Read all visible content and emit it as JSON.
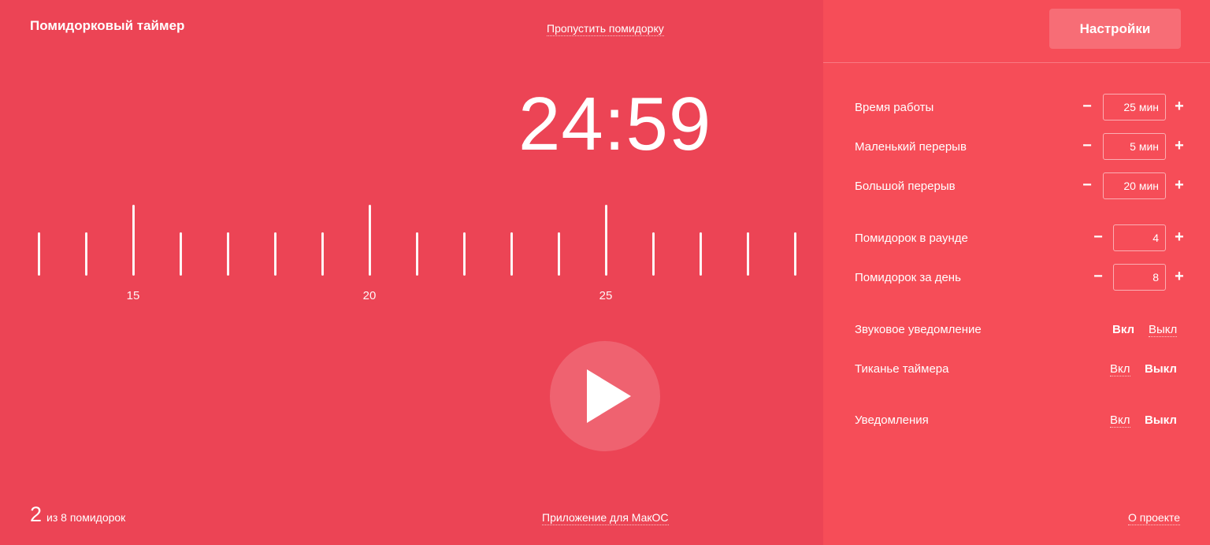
{
  "app": {
    "title": "Помидорковый таймер"
  },
  "header": {
    "skip_label": "Пропустить помидорку"
  },
  "timer": {
    "display": "24:59"
  },
  "ruler": {
    "labels": [
      "15",
      "20",
      "25"
    ]
  },
  "player": {
    "icon": "play-icon"
  },
  "counter": {
    "done": "2",
    "text": "из 8 помидорок"
  },
  "footer": {
    "macos_label": "Приложение для МакОС",
    "about_label": "О проекте"
  },
  "settings": {
    "button_label": "Настройки",
    "minus_label": "−",
    "plus_label": "+",
    "work_time": {
      "label": "Время работы",
      "value": "25 мин"
    },
    "short_break": {
      "label": "Маленький перерыв",
      "value": "5 мин"
    },
    "long_break": {
      "label": "Большой перерыв",
      "value": "20 мин"
    },
    "per_round": {
      "label": "Помидорок в раунде",
      "value": "4"
    },
    "per_day": {
      "label": "Помидорок за день",
      "value": "8"
    },
    "sound": {
      "label": "Звуковое уведомление",
      "on": "Вкл",
      "off": "Выкл",
      "selected": "on"
    },
    "ticking": {
      "label": "Тиканье таймера",
      "on": "Вкл",
      "off": "Выкл",
      "selected": "off"
    },
    "notifications": {
      "label": "Уведомления",
      "on": "Вкл",
      "off": "Выкл",
      "selected": "off"
    }
  },
  "colors": {
    "main_bg": "#ec4455",
    "side_bg": "#f64d58",
    "text": "#ffffff"
  }
}
